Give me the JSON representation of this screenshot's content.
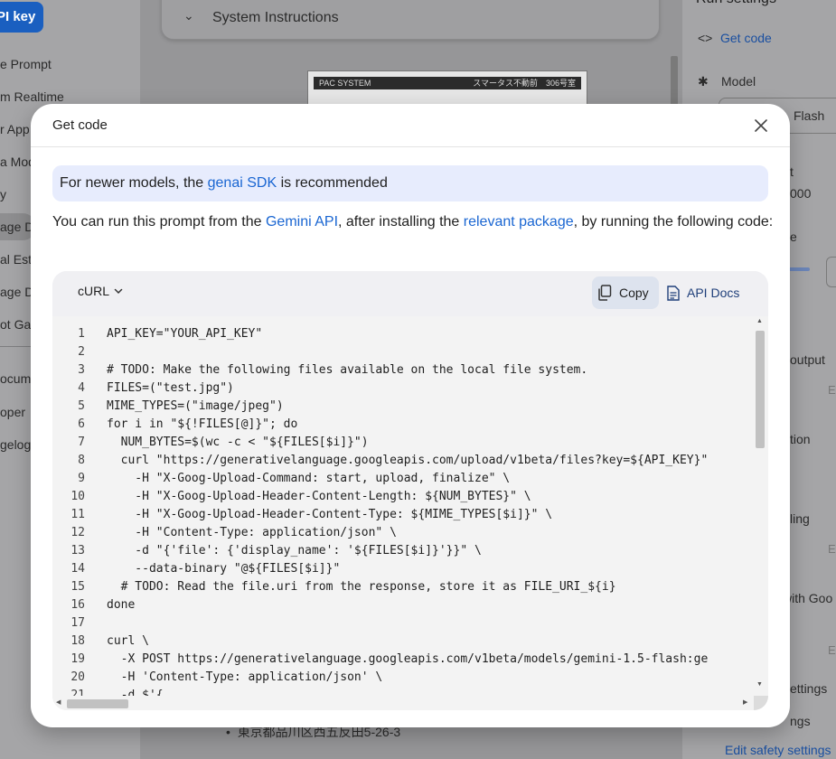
{
  "background": {
    "left_nav": {
      "api_key_button": "PI key",
      "items": [
        "e Prompt",
        "m Realtime",
        "r App",
        "a Mod",
        "y",
        "age D",
        "al Est",
        "age D",
        "ot Gal",
        "ocum",
        "oper",
        "gelog"
      ]
    },
    "system_instructions": "System Instructions",
    "image_header_left": "PAC SYSTEM",
    "image_header_right": "スマータス不動前　306号室",
    "bullet_text": "東京都品川区西五反田5-26-3",
    "right_panel": {
      "run_settings": "Run settings",
      "get_code": "Get code",
      "model_label": "Model",
      "model_value": "Flash",
      "token_partial": "t",
      "token_value": "000",
      "temperature_partial": "e",
      "output_partial": "output",
      "tion_partial": "tion",
      "ling_partial": "ling",
      "goo_partial": "with Goo",
      "settings_partial": "ettings",
      "ngs_partial": "ngs",
      "edit_safety": "Edit safety settings",
      "e_letter": "E"
    }
  },
  "modal": {
    "title": "Get code",
    "notice": {
      "prefix": "For newer models, the ",
      "link": "genai SDK",
      "suffix": " is recommended"
    },
    "description": {
      "part1": "You can run this prompt from the ",
      "link1": "Gemini API",
      "part2": ", after installing the ",
      "link2": "relevant package",
      "part3": ", by running the following code:"
    },
    "language": "cURL",
    "copy_label": "Copy",
    "docs_label": "API Docs",
    "code_lines": [
      {
        "n": "1",
        "text": "API_KEY=\"YOUR_API_KEY\""
      },
      {
        "n": "2",
        "text": ""
      },
      {
        "n": "3",
        "text": "# TODO: Make the following files available on the local file system."
      },
      {
        "n": "4",
        "text": "FILES=(\"test.jpg\")"
      },
      {
        "n": "5",
        "text": "MIME_TYPES=(\"image/jpeg\")"
      },
      {
        "n": "6",
        "text": "for i in \"${!FILES[@]}\"; do"
      },
      {
        "n": "7",
        "text": "  NUM_BYTES=$(wc -c < \"${FILES[$i]}\")"
      },
      {
        "n": "8",
        "text": "  curl \"https://generativelanguage.googleapis.com/upload/v1beta/files?key=${API_KEY}\""
      },
      {
        "n": "9",
        "text": "    -H \"X-Goog-Upload-Command: start, upload, finalize\" \\"
      },
      {
        "n": "10",
        "text": "    -H \"X-Goog-Upload-Header-Content-Length: ${NUM_BYTES}\" \\"
      },
      {
        "n": "11",
        "text": "    -H \"X-Goog-Upload-Header-Content-Type: ${MIME_TYPES[$i]}\" \\"
      },
      {
        "n": "12",
        "text": "    -H \"Content-Type: application/json\" \\"
      },
      {
        "n": "13",
        "text": "    -d \"{'file': {'display_name': '${FILES[$i]}'}}\" \\"
      },
      {
        "n": "14",
        "text": "    --data-binary \"@${FILES[$i]}\""
      },
      {
        "n": "15",
        "text": "  # TODO: Read the file.uri from the response, store it as FILE_URI_${i}"
      },
      {
        "n": "16",
        "text": "done"
      },
      {
        "n": "17",
        "text": ""
      },
      {
        "n": "18",
        "text": "curl \\"
      },
      {
        "n": "19",
        "text": "  -X POST https://generativelanguage.googleapis.com/v1beta/models/gemini-1.5-flash:ge"
      },
      {
        "n": "20",
        "text": "  -H 'Content-Type: application/json' \\"
      },
      {
        "n": "21",
        "text": "  -d $'{"
      }
    ]
  }
}
